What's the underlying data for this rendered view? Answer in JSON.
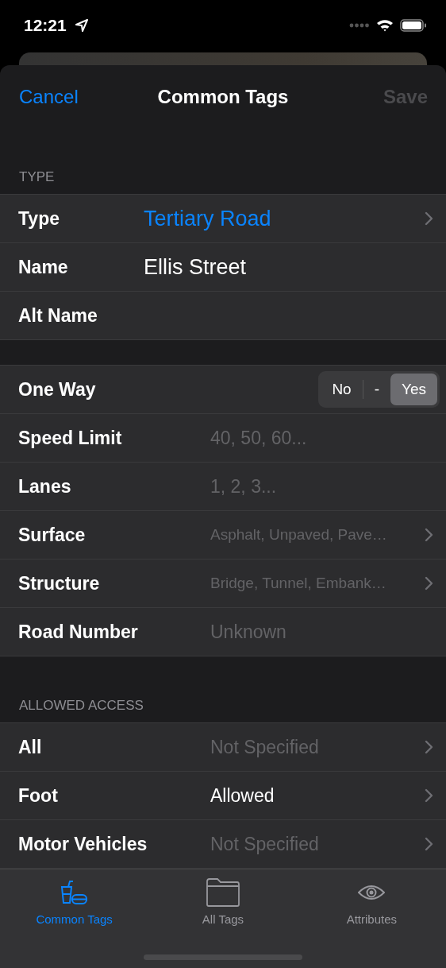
{
  "status_bar": {
    "time": "12:21"
  },
  "nav": {
    "cancel": "Cancel",
    "title": "Common Tags",
    "save": "Save",
    "save_disabled": true
  },
  "sections": [
    {
      "header": "TYPE",
      "rows": [
        {
          "kind": "link",
          "label": "Type",
          "value": "Tertiary Road"
        },
        {
          "kind": "field",
          "label": "Name",
          "value": "Ellis Street"
        },
        {
          "kind": "field",
          "label": "Alt Name"
        }
      ]
    },
    {
      "rows": [
        {
          "kind": "segmented",
          "label": "One Way",
          "options": [
            {
              "label": "No",
              "selected": false
            },
            {
              "label": "-",
              "selected": false
            },
            {
              "label": "Yes",
              "selected": true
            }
          ]
        },
        {
          "kind": "field",
          "label": "Speed Limit",
          "placeholder": "40, 50, 60..."
        },
        {
          "kind": "field",
          "label": "Lanes",
          "placeholder": "1, 2, 3..."
        },
        {
          "kind": "picker",
          "label": "Surface",
          "placeholder": "Asphalt, Unpaved, Pave…"
        },
        {
          "kind": "picker",
          "label": "Structure",
          "placeholder": "Bridge, Tunnel, Embank…"
        },
        {
          "kind": "field",
          "label": "Road Number",
          "placeholder": "Unknown"
        }
      ]
    },
    {
      "header": "ALLOWED ACCESS",
      "rows": [
        {
          "kind": "picker",
          "label": "All",
          "placeholder": "Not Specified"
        },
        {
          "kind": "picker",
          "label": "Foot",
          "value": "Allowed"
        },
        {
          "kind": "picker",
          "label": "Motor Vehicles",
          "placeholder": "Not Specified"
        }
      ]
    }
  ],
  "tabs": [
    {
      "label": "Common Tags",
      "selected": true
    },
    {
      "label": "All Tags",
      "selected": false
    },
    {
      "label": "Attributes",
      "selected": false
    }
  ]
}
